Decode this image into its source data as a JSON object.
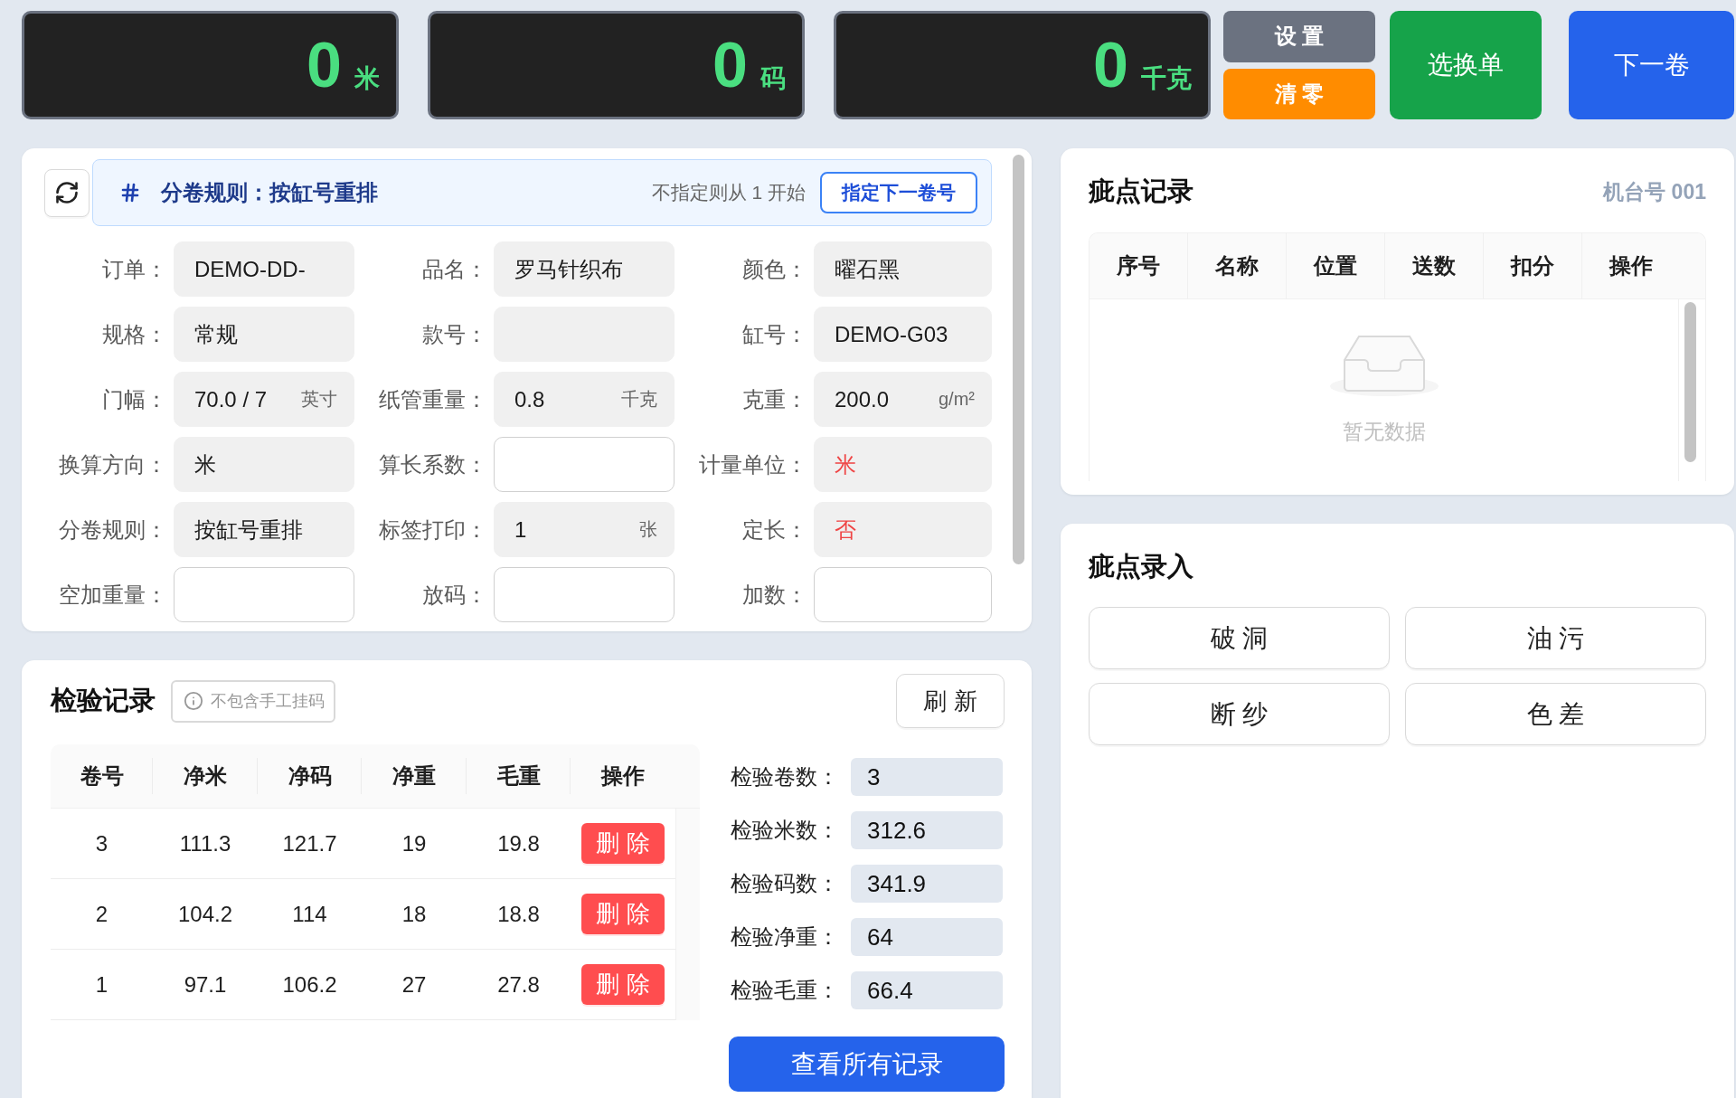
{
  "counters": [
    {
      "value": "0",
      "unit": "米"
    },
    {
      "value": "0",
      "unit": "码"
    },
    {
      "value": "0",
      "unit": "千克"
    }
  ],
  "toolbar": {
    "small_buttons": [
      {
        "label": "设 置",
        "kind": "neutral"
      },
      {
        "label": "清 零",
        "kind": "warning"
      }
    ],
    "large_buttons": [
      {
        "label": "选换单",
        "kind": "success"
      },
      {
        "label": "下一卷",
        "kind": "primary"
      }
    ]
  },
  "roll_rule": {
    "title": "分卷规则：按缸号重排",
    "hint": "不指定则从 1 开始",
    "button": "指定下一卷号"
  },
  "form": {
    "fields": [
      {
        "label": "订单：",
        "kind": "display",
        "value": "DEMO-DD-",
        "warning": false
      },
      {
        "label": "品名：",
        "kind": "display",
        "value": "罗马针织布",
        "warning": false
      },
      {
        "label": "颜色：",
        "kind": "display",
        "value": "曜石黑",
        "warning": false
      },
      {
        "label": "规格：",
        "kind": "display",
        "value": "常规",
        "warning": false
      },
      {
        "label": "款号：",
        "kind": "display",
        "warning": false
      },
      {
        "label": "缸号：",
        "kind": "display",
        "value": "DEMO-G03",
        "warning": false
      },
      {
        "label": "门幅：",
        "kind": "display",
        "value": "70.0 / 7",
        "unit": "英寸",
        "warning": false
      },
      {
        "label": "纸管重量：",
        "kind": "display",
        "value": "0.8",
        "unit": "千克",
        "warning": false
      },
      {
        "label": "克重：",
        "kind": "display",
        "value": "200.0",
        "unit": "g/m²",
        "warning": false
      },
      {
        "label": "换算方向：",
        "kind": "display",
        "value": "米",
        "warning": false
      },
      {
        "label": "算长系数：",
        "kind": "entry",
        "warning": false
      },
      {
        "label": "计量单位：",
        "kind": "display",
        "value": "米",
        "warning": true
      },
      {
        "label": "分卷规则：",
        "kind": "display",
        "value": "按缸号重排",
        "warning": false
      },
      {
        "label": "标签打印：",
        "kind": "display",
        "value": "1",
        "unit": "张",
        "warning": false
      },
      {
        "label": "定长：",
        "kind": "display",
        "value": "否",
        "warning": true
      },
      {
        "label": "空加重量：",
        "kind": "entry",
        "warning": false
      },
      {
        "label": "放码：",
        "kind": "entry",
        "warning": false
      },
      {
        "label": "加数：",
        "kind": "entry",
        "warning": false
      }
    ]
  },
  "defect_log": {
    "title": "疵点记录",
    "machine": "机台号 001",
    "columns": [
      "序号",
      "名称",
      "位置",
      "送数",
      "扣分",
      "操作"
    ],
    "empty_text": "暂无数据"
  },
  "defect_entry": {
    "title": "疵点录入",
    "buttons": [
      "破 洞",
      "油 污",
      "断 纱",
      "色 差"
    ]
  },
  "inspection": {
    "title": "检验记录",
    "note": "不包含手工挂码",
    "refresh": "刷 新",
    "columns": [
      "卷号",
      "净米",
      "净码",
      "净重",
      "毛重",
      "操作"
    ],
    "rows": [
      {
        "cells": [
          "3",
          "111.3",
          "121.7",
          "19",
          "19.8"
        ],
        "action": "删 除"
      },
      {
        "cells": [
          "2",
          "104.2",
          "114",
          "18",
          "18.8"
        ],
        "action": "删 除"
      },
      {
        "cells": [
          "1",
          "97.1",
          "106.2",
          "27",
          "27.8"
        ],
        "action": "删 除"
      }
    ],
    "stats": [
      {
        "label": "检验卷数：",
        "value": "3"
      },
      {
        "label": "检验米数：",
        "value": "312.6"
      },
      {
        "label": "检验码数：",
        "value": "341.9"
      },
      {
        "label": "检验净重：",
        "value": "64"
      },
      {
        "label": "检验毛重：",
        "value": "66.4"
      }
    ],
    "view_all": "查看所有记录"
  }
}
